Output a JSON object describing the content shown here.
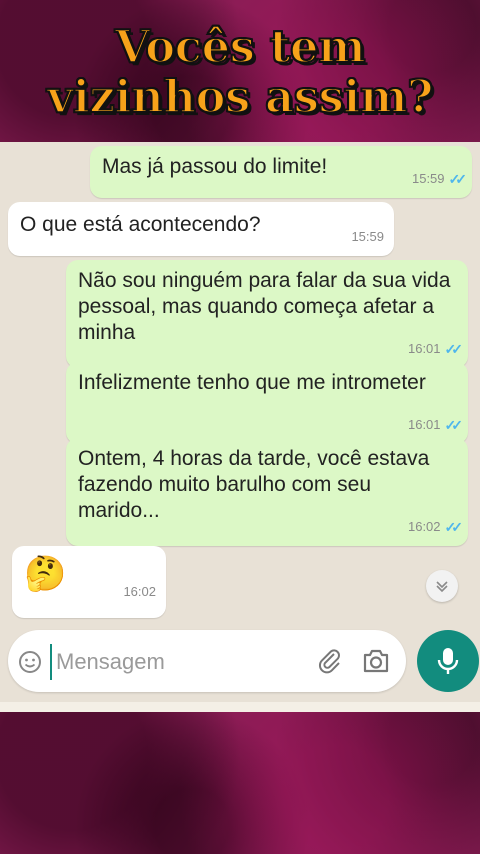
{
  "headline": {
    "line1": "Vocês tem",
    "line2": "vizinhos assim?"
  },
  "messages": [
    {
      "text": "Mas já passou do limite!",
      "time": "15:59",
      "direction": "outgoing",
      "ticks": "✓✓"
    },
    {
      "text": "O que está acontecendo?",
      "time": "15:59",
      "direction": "incoming"
    },
    {
      "text": "Não sou ninguém para falar da sua vida pessoal, mas quando começa afetar a minha",
      "time": "16:01",
      "direction": "outgoing",
      "ticks": "✓✓"
    },
    {
      "text": "Infelizmente tenho que  me intrometer",
      "time": "16:01",
      "direction": "outgoing",
      "ticks": "✓✓"
    },
    {
      "text": "Ontem, 4 horas da tarde, você estava fazendo muito barulho com seu marido...",
      "time": "16:02",
      "direction": "outgoing",
      "ticks": "✓✓"
    },
    {
      "text": "🤔",
      "time": "16:02",
      "direction": "incoming"
    }
  ],
  "composer": {
    "placeholder": "Mensagem"
  },
  "icons": {
    "emoji": "emoji-icon",
    "attach": "paperclip-icon",
    "camera": "camera-icon",
    "mic": "microphone-icon",
    "scroll": "chevron-down-icon"
  },
  "colors": {
    "outgoing_bubble": "#dcf8c6",
    "incoming_bubble": "#ffffff",
    "chat_background": "#e8e1d6",
    "accent": "#128c7e",
    "read_ticks": "#4fb6ec",
    "headline": "#f7a21a",
    "frame": "#8a1d55"
  }
}
